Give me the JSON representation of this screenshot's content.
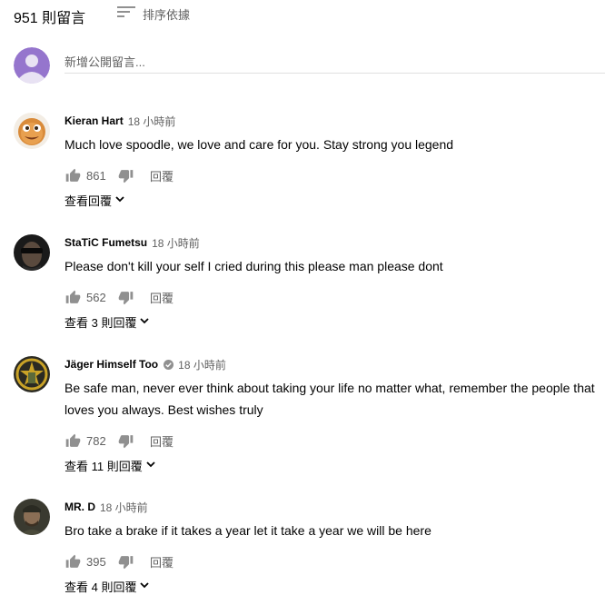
{
  "header": {
    "comment_count": "951 則留言",
    "sort_label": "排序依據"
  },
  "new_comment": {
    "placeholder": "新增公開留言..."
  },
  "comments": [
    {
      "author": "Kieran Hart",
      "time": "18 小時前",
      "text": "Much love spoodle, we love and care for you. Stay strong you legend",
      "likes": "861",
      "reply_label": "回覆",
      "view_replies": "查看回覆"
    },
    {
      "author": "StaTiC Fumetsu",
      "time": "18 小時前",
      "text": "Please don't kill your self I cried during this please man please dont",
      "likes": "562",
      "reply_label": "回覆",
      "view_replies": "查看 3 則回覆"
    },
    {
      "author": "Jäger Himself Too",
      "time": "18 小時前",
      "text": "Be safe man,  never ever think about taking your life no matter what, remember the people that loves you always. Best wishes truly",
      "likes": "782",
      "reply_label": "回覆",
      "view_replies": "查看 11 則回覆",
      "verified": true
    },
    {
      "author": "MR. D",
      "time": "18 小時前",
      "text": "Bro take a brake if it takes a year let it take a year we will be here",
      "likes": "395",
      "reply_label": "回覆",
      "view_replies": "查看 4 則回覆"
    }
  ],
  "icons": {
    "sort": "sort-icon",
    "like": "thumbs-up-icon",
    "dislike": "thumbs-down-icon",
    "expand": "chevron-down-icon",
    "verified": "verified-check-icon"
  },
  "colors": {
    "secondary_text": "#606060",
    "self_avatar": "#9575cd"
  }
}
